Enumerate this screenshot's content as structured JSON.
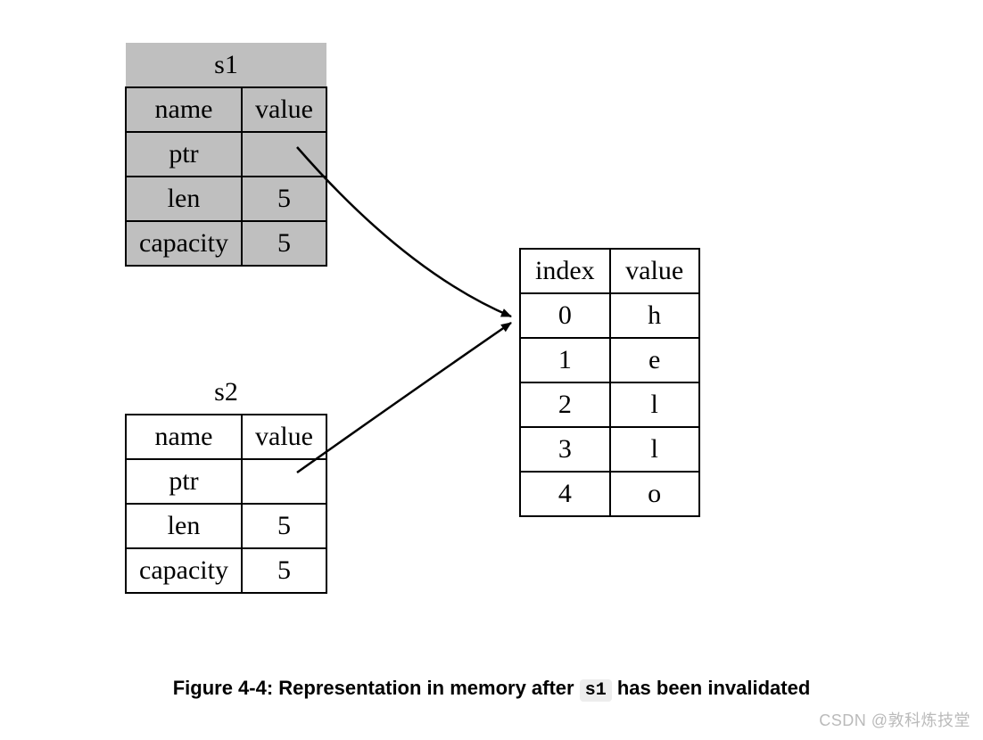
{
  "s1": {
    "title": "s1",
    "header_name": "name",
    "header_value": "value",
    "rows": [
      {
        "name": "ptr",
        "value": ""
      },
      {
        "name": "len",
        "value": "5"
      },
      {
        "name": "capacity",
        "value": "5"
      }
    ]
  },
  "s2": {
    "title": "s2",
    "header_name": "name",
    "header_value": "value",
    "rows": [
      {
        "name": "ptr",
        "value": ""
      },
      {
        "name": "len",
        "value": "5"
      },
      {
        "name": "capacity",
        "value": "5"
      }
    ]
  },
  "heap": {
    "header_index": "index",
    "header_value": "value",
    "rows": [
      {
        "index": "0",
        "value": "h"
      },
      {
        "index": "1",
        "value": "e"
      },
      {
        "index": "2",
        "value": "l"
      },
      {
        "index": "3",
        "value": "l"
      },
      {
        "index": "4",
        "value": "o"
      }
    ]
  },
  "caption": {
    "prefix": "Figure 4-4: Representation in memory after ",
    "code": "s1",
    "suffix": " has been invalidated"
  },
  "watermark": "CSDN @敦科炼技堂"
}
